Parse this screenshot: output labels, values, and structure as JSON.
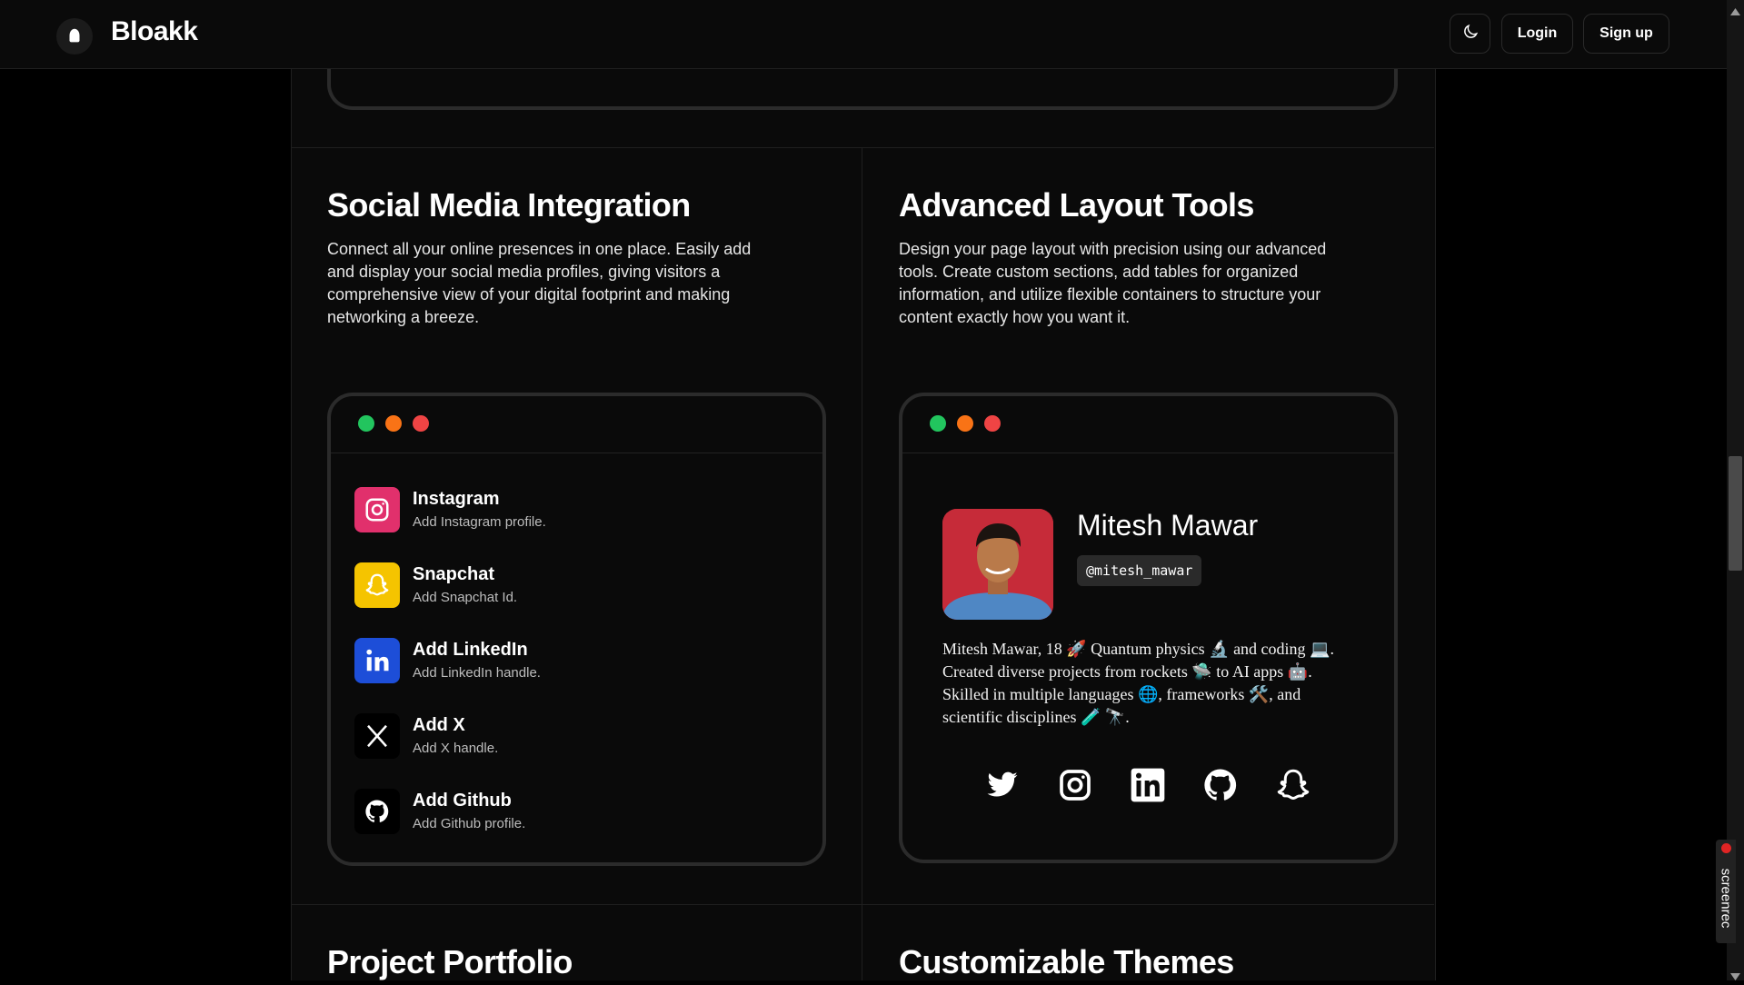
{
  "header": {
    "brand": "Bloakk",
    "login_label": "Login",
    "signup_label": "Sign up",
    "theme_icon": "moon-icon"
  },
  "sections": {
    "social": {
      "title": "Social Media Integration",
      "description": "Connect all your online presences in one place. Easily add and display your social media profiles, giving visitors a comprehensive view of your digital footprint and making networking a breeze."
    },
    "layout": {
      "title": "Advanced Layout Tools",
      "description": "Design your page layout with precision using our advanced tools. Create custom sections, add tables for organized information, and utilize flexible containers to structure your content exactly how you want it."
    },
    "portfolio": {
      "title": "Project Portfolio"
    },
    "themes": {
      "title": "Customizable Themes"
    }
  },
  "window_dots": {
    "green": "#22c55e",
    "orange": "#f97316",
    "red": "#ef4444"
  },
  "social_items": [
    {
      "title": "Instagram",
      "subtitle": "Add Instagram profile.",
      "icon": "instagram-icon",
      "color": "#e1306c"
    },
    {
      "title": "Snapchat",
      "subtitle": "Add Snapchat Id.",
      "icon": "snapchat-icon",
      "color": "#f5c400"
    },
    {
      "title": "Add LinkedIn",
      "subtitle": "Add LinkedIn handle.",
      "icon": "linkedin-icon",
      "color": "#1d4ed8"
    },
    {
      "title": "Add X",
      "subtitle": "Add X handle.",
      "icon": "x-icon",
      "color": "#000000"
    },
    {
      "title": "Add Github",
      "subtitle": "Add Github profile.",
      "icon": "github-icon",
      "color": "#000000"
    }
  ],
  "profile": {
    "name": "Mitesh Mawar",
    "handle": "@mitesh_mawar",
    "bio": "Mitesh Mawar, 18 🚀 Quantum physics 🔬 and coding 💻. Created diverse projects from rockets 🛸 to AI apps 🤖. Skilled in multiple languages 🌐, frameworks 🛠️, and scientific disciplines 🧪 🔭.",
    "social_icons": [
      "twitter-icon",
      "instagram-icon",
      "linkedin-icon",
      "github-icon",
      "snapchat-icon"
    ]
  },
  "overlay": {
    "screenrec_label": "screenrec"
  }
}
